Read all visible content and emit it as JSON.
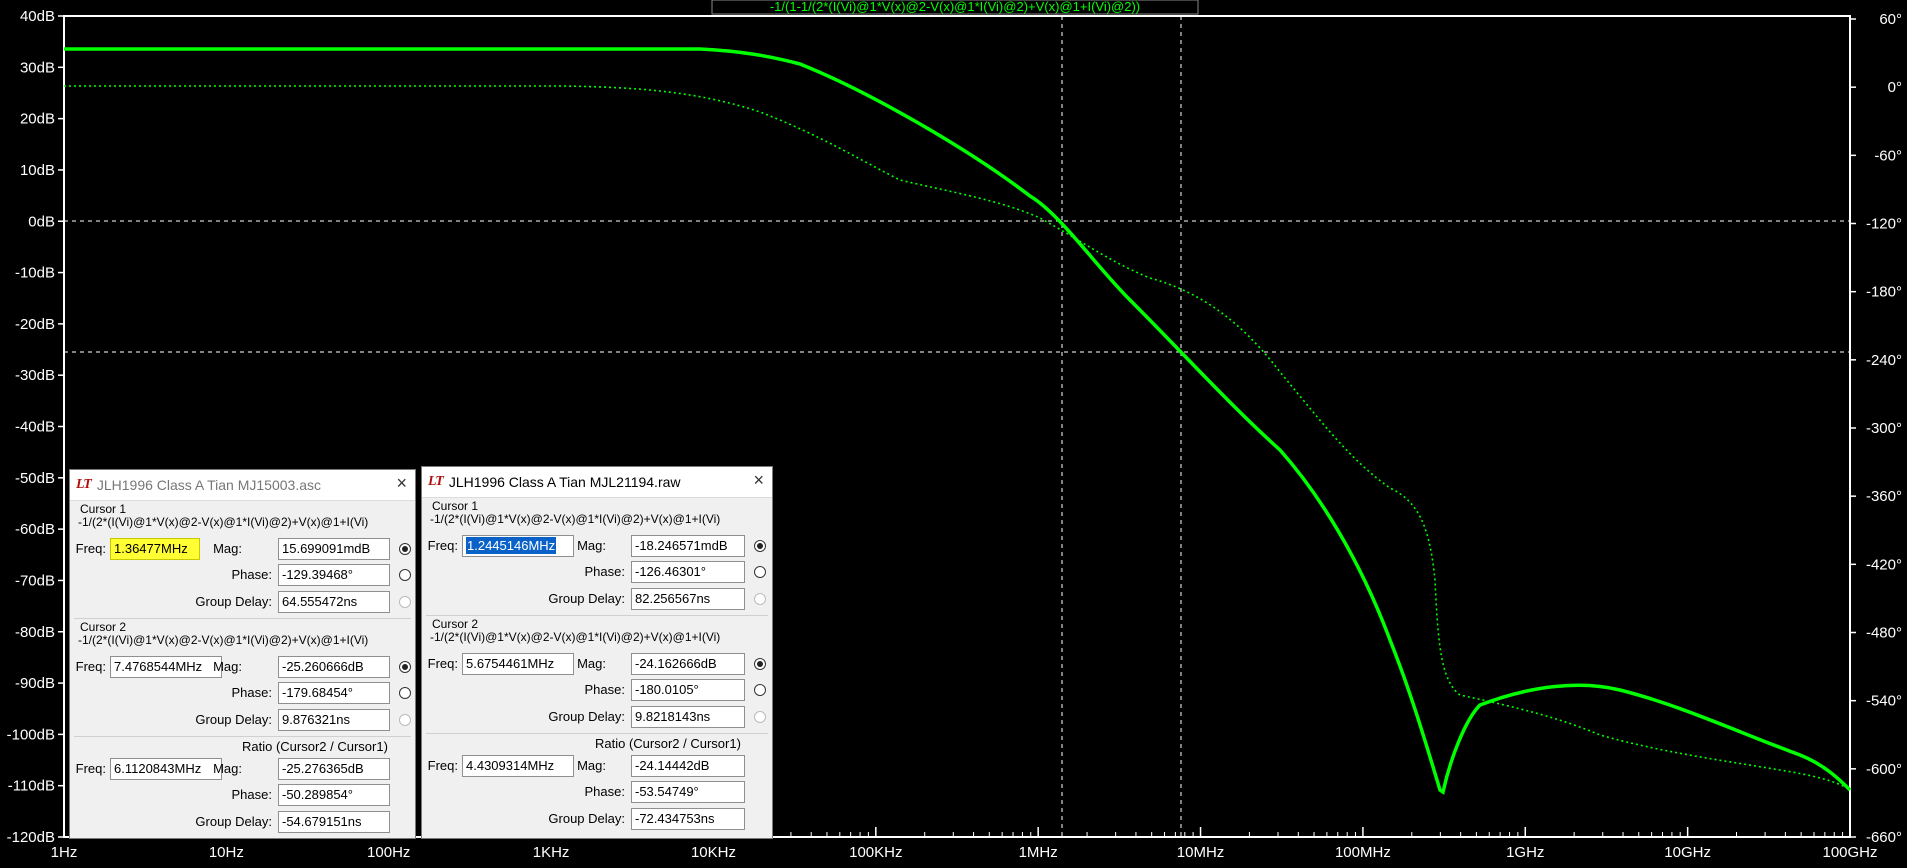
{
  "plot": {
    "expression": "-1/(1-1/(2*(I(Vi)@1*V(x)@2-V(x)@1*I(Vi)@2)+V(x)@1+I(Vi)@2))",
    "left_axis": [
      "40dB",
      "30dB",
      "20dB",
      "10dB",
      "0dB",
      "-10dB",
      "-20dB",
      "-30dB",
      "-40dB",
      "-50dB",
      "-60dB",
      "-70dB",
      "-80dB",
      "-90dB",
      "-100dB",
      "-110dB",
      "-120dB"
    ],
    "right_axis": [
      "60°",
      "0°",
      "-60°",
      "-120°",
      "-180°",
      "-240°",
      "-300°",
      "-360°",
      "-420°",
      "-480°",
      "-540°",
      "-600°",
      "-660°"
    ],
    "x_axis": [
      "1Hz",
      "10Hz",
      "100Hz",
      "1KHz",
      "10KHz",
      "100KHz",
      "1MHz",
      "10MHz",
      "100MHz",
      "1GHz",
      "10GHz",
      "100GHz"
    ],
    "trace_color": "#00ff00",
    "grid_color": "#ffffff",
    "axis_color": "#ffffff"
  },
  "window1": {
    "title": "JLH1996 Class A Tian MJ15003.asc",
    "logo": "LT",
    "close": "×",
    "cursor1": {
      "header": "Cursor 1",
      "expr": "-1/(2*(I(Vi)@1*V(x)@2-V(x)@1*I(Vi)@2)+V(x)@1+I(Vi)",
      "freq_label": "Freq:",
      "freq": "1.36477MHz",
      "mag_label": "Mag:",
      "mag": "15.699091mdB",
      "phase_label": "Phase:",
      "phase": "-129.39468°",
      "gd_label": "Group Delay:",
      "gd": "64.555472ns"
    },
    "cursor2": {
      "header": "Cursor 2",
      "expr": "-1/(2*(I(Vi)@1*V(x)@2-V(x)@1*I(Vi)@2)+V(x)@1+I(Vi)",
      "freq_label": "Freq:",
      "freq": "7.4768544MHz",
      "mag_label": "Mag:",
      "mag": "-25.260666dB",
      "phase_label": "Phase:",
      "phase": "-179.68454°",
      "gd_label": "Group Delay:",
      "gd": "9.876321ns"
    },
    "ratio": {
      "header": "Ratio (Cursor2 / Cursor1)",
      "freq_label": "Freq:",
      "freq": "6.1120843MHz",
      "mag_label": "Mag:",
      "mag": "-25.276365dB",
      "phase_label": "Phase:",
      "phase": "-50.289854°",
      "gd_label": "Group Delay:",
      "gd": "-54.679151ns"
    }
  },
  "window2": {
    "title": "JLH1996 Class A Tian MJL21194.raw",
    "logo": "LT",
    "close": "×",
    "cursor1": {
      "header": "Cursor 1",
      "expr": "-1/(2*(I(Vi)@1*V(x)@2-V(x)@1*I(Vi)@2)+V(x)@1+I(Vi)",
      "freq_label": "Freq:",
      "freq": "1.2445146MHz",
      "mag_label": "Mag:",
      "mag": "-18.246571mdB",
      "phase_label": "Phase:",
      "phase": "-126.46301°",
      "gd_label": "Group Delay:",
      "gd": "82.256567ns"
    },
    "cursor2": {
      "header": "Cursor 2",
      "expr": "-1/(2*(I(Vi)@1*V(x)@2-V(x)@1*I(Vi)@2)+V(x)@1+I(Vi)",
      "freq_label": "Freq:",
      "freq": "5.6754461MHz",
      "mag_label": "Mag:",
      "mag": "-24.162666dB",
      "phase_label": "Phase:",
      "phase": "-180.0105°",
      "gd_label": "Group Delay:",
      "gd": "9.8218143ns"
    },
    "ratio": {
      "header": "Ratio (Cursor2 / Cursor1)",
      "freq_label": "Freq:",
      "freq": "4.4309314MHz",
      "mag_label": "Mag:",
      "mag": "-24.14442dB",
      "phase_label": "Phase:",
      "phase": "-53.54749°",
      "gd_label": "Group Delay:",
      "gd": "-72.434753ns"
    }
  }
}
